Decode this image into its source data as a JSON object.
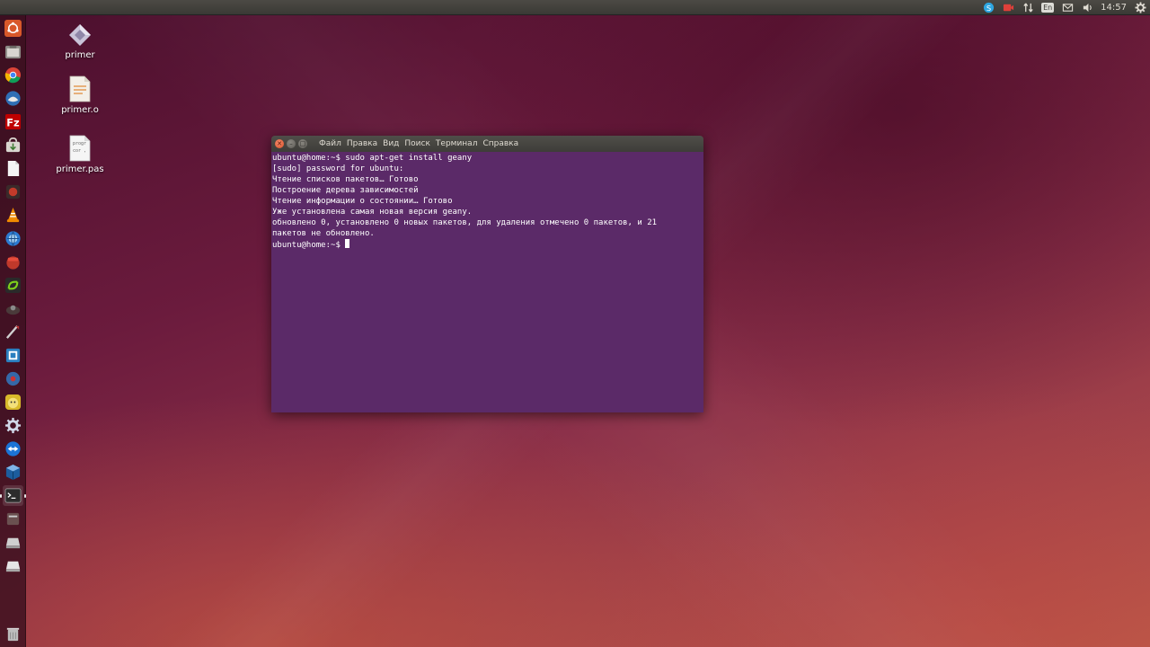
{
  "top_panel": {
    "keyboard_layout": "En",
    "clock": "14:57"
  },
  "desktop": {
    "icons": [
      {
        "label": "primer"
      },
      {
        "label": "primer.o"
      },
      {
        "label": "primer.pas",
        "preview_text_1": "progr",
        "preview_text_2": "cor ,"
      }
    ]
  },
  "launcher": {
    "items": [
      "ubuntu-dash-icon",
      "files-icon",
      "chrome-icon",
      "thunderbird-icon",
      "filezilla-icon",
      "software-center-icon",
      "libreoffice-writer-icon",
      "app-icon",
      "vlc-icon",
      "browser-icon",
      "app-icon",
      "app-icon",
      "app-icon",
      "app-icon",
      "app-icon",
      "pidgin-icon",
      "settings-icon",
      "teamviewer-icon",
      "virtualbox-icon",
      "terminal-icon",
      "app-icon",
      "drive-icon",
      "drive-icon",
      "trash-icon"
    ]
  },
  "terminal": {
    "menu": [
      "Файл",
      "Правка",
      "Вид",
      "Поиск",
      "Терминал",
      "Справка"
    ],
    "lines": [
      "ubuntu@home:~$ sudo apt-get install geany",
      "[sudo] password for ubuntu:",
      "Чтение списков пакетов… Готово",
      "Построение дерева зависимостей",
      "Чтение информации о состоянии… Готово",
      "Уже установлена самая новая версия geany.",
      "обновлено 0, установлено 0 новых пакетов, для удаления отмечено 0 пакетов, и 21",
      "пакетов не обновлено."
    ],
    "prompt": "ubuntu@home:~$ ",
    "colors": {
      "background": "#5b2a68",
      "text": "#ffffff"
    }
  }
}
